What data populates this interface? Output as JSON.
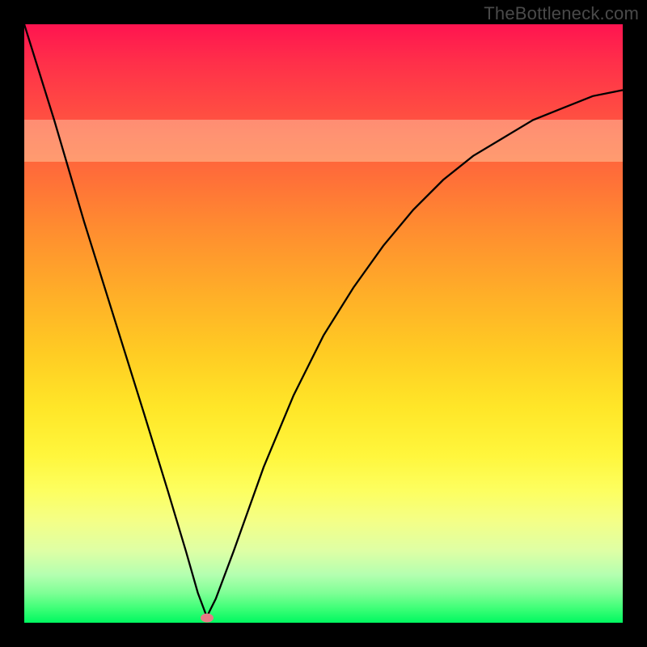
{
  "watermark": "TheBottleneck.com",
  "colors": {
    "frame": "#000000",
    "curve": "#000000",
    "marker": "#e77a86"
  },
  "chart_data": {
    "type": "line",
    "title": "",
    "xlabel": "",
    "ylabel": "",
    "xlim": [
      0,
      100
    ],
    "ylim": [
      0,
      100
    ],
    "series": [
      {
        "name": "bottleneck-curve",
        "x": [
          0,
          5,
          10,
          15,
          20,
          24,
          27,
          29,
          30.5,
          32,
          35,
          40,
          45,
          50,
          55,
          60,
          65,
          70,
          75,
          80,
          85,
          90,
          95,
          100
        ],
        "values": [
          100,
          84,
          67,
          51,
          35,
          22,
          12,
          5,
          1,
          4,
          12,
          26,
          38,
          48,
          56,
          63,
          69,
          74,
          78,
          81,
          84,
          86,
          88,
          89
        ]
      }
    ],
    "highlight_band_y": [
      77,
      84
    ],
    "marker": {
      "x": 30.5,
      "y": 0.8
    },
    "background_gradient": {
      "top": "#ff1450",
      "mid": "#ffe628",
      "bottom": "#00f860"
    }
  }
}
